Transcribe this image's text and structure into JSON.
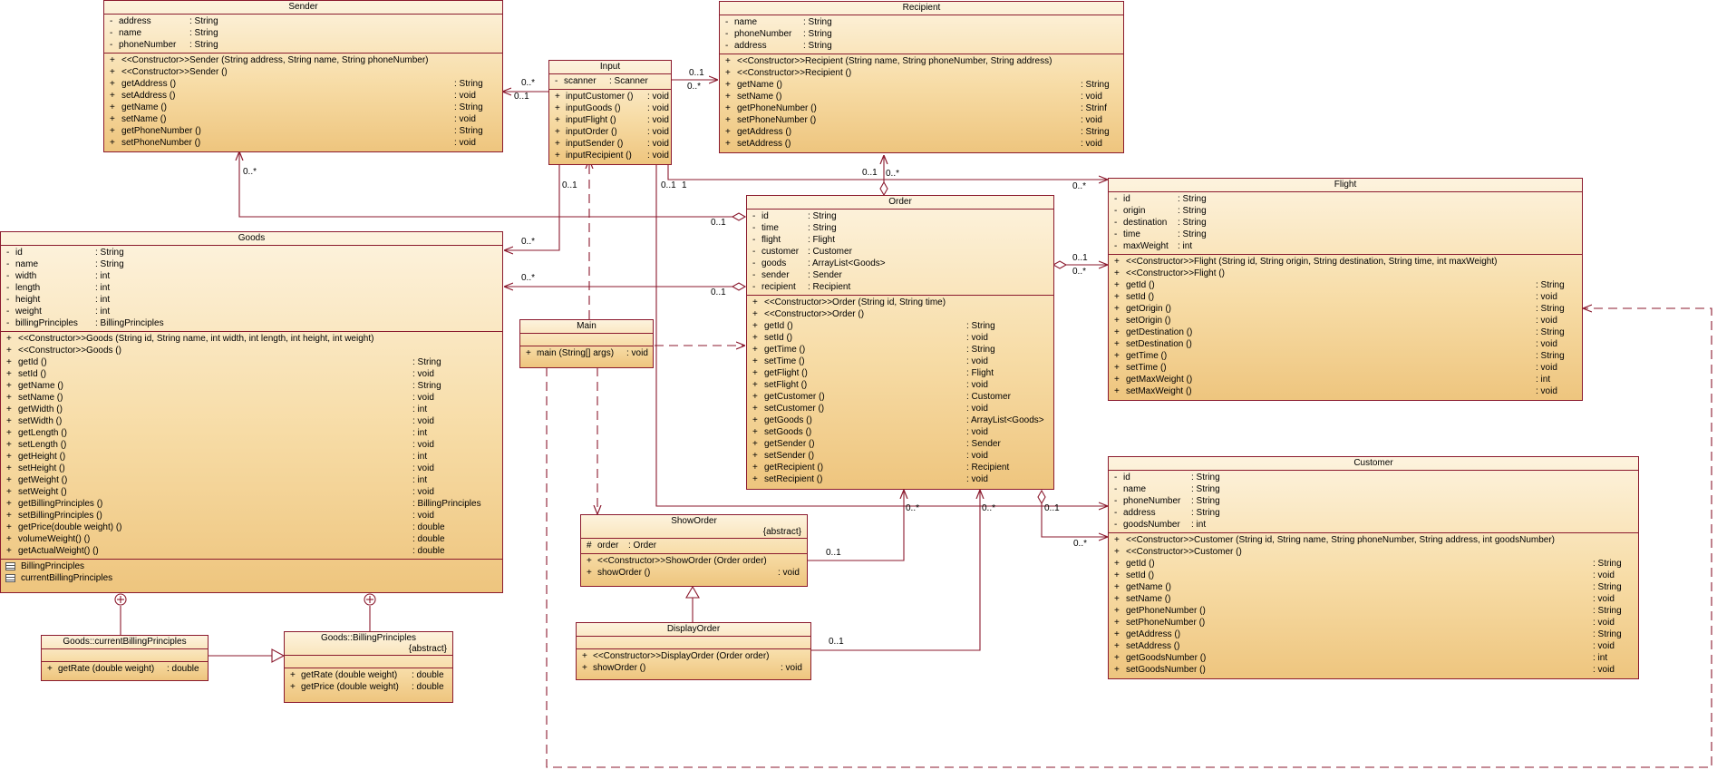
{
  "colors": {
    "border": "#8b1a2e",
    "fill_top": "#fdf3de",
    "fill_bottom": "#eec57e",
    "line": "#8b1a2e"
  },
  "classes": {
    "sender": {
      "name": "Sender",
      "attrs": [
        {
          "v": "-",
          "n": "address",
          "t": ": String"
        },
        {
          "v": "-",
          "n": "name",
          "t": ": String"
        },
        {
          "v": "-",
          "n": "phoneNumber",
          "t": ": String"
        }
      ],
      "ops": [
        {
          "v": "+",
          "n": "<<Constructor>>Sender (String  address, String  name, String  phoneNumber)",
          "t": ""
        },
        {
          "v": "+",
          "n": "<<Constructor>>Sender ()",
          "t": ""
        },
        {
          "v": "+",
          "n": "getAddress ()",
          "t": ": String"
        },
        {
          "v": "+",
          "n": "setAddress ()",
          "t": ": void"
        },
        {
          "v": "+",
          "n": "getName ()",
          "t": ": String"
        },
        {
          "v": "+",
          "n": "setName ()",
          "t": ": void"
        },
        {
          "v": "+",
          "n": "getPhoneNumber ()",
          "t": ": String"
        },
        {
          "v": "+",
          "n": "setPhoneNumber ()",
          "t": ": void"
        }
      ]
    },
    "input": {
      "name": "Input",
      "attrs": [
        {
          "v": "-",
          "n": "scanner",
          "t": ": Scanner"
        }
      ],
      "ops": [
        {
          "v": "+",
          "n": "inputCustomer ()",
          "t": ": void"
        },
        {
          "v": "+",
          "n": "inputGoods ()",
          "t": ": void"
        },
        {
          "v": "+",
          "n": "inputFlight ()",
          "t": ": void"
        },
        {
          "v": "+",
          "n": "inputOrder ()",
          "t": ": void"
        },
        {
          "v": "+",
          "n": "inputSender ()",
          "t": ": void"
        },
        {
          "v": "+",
          "n": "inputRecipient ()",
          "t": ": void"
        }
      ]
    },
    "recipient": {
      "name": "Recipient",
      "attrs": [
        {
          "v": "-",
          "n": "name",
          "t": ": String"
        },
        {
          "v": "-",
          "n": "phoneNumber",
          "t": ": String"
        },
        {
          "v": "-",
          "n": "address",
          "t": ": String"
        }
      ],
      "ops": [
        {
          "v": "+",
          "n": "<<Constructor>>Recipient (String  name, String  phoneNumber, String  address)",
          "t": ""
        },
        {
          "v": "+",
          "n": "<<Constructor>>Recipient ()",
          "t": ""
        },
        {
          "v": "+",
          "n": "getName ()",
          "t": ": String"
        },
        {
          "v": "+",
          "n": "setName ()",
          "t": ": void"
        },
        {
          "v": "+",
          "n": "getPhoneNumber ()",
          "t": ": Strinf"
        },
        {
          "v": "+",
          "n": "setPhoneNumber ()",
          "t": ": void"
        },
        {
          "v": "+",
          "n": "getAddress ()",
          "t": ": String"
        },
        {
          "v": "+",
          "n": "setAddress ()",
          "t": ": void"
        }
      ]
    },
    "flight": {
      "name": "Flight",
      "attrs": [
        {
          "v": "-",
          "n": "id",
          "t": ": String"
        },
        {
          "v": "-",
          "n": "origin",
          "t": ": String"
        },
        {
          "v": "-",
          "n": "destination",
          "t": ": String"
        },
        {
          "v": "-",
          "n": "time",
          "t": ": String"
        },
        {
          "v": "-",
          "n": "maxWeight",
          "t": ": int"
        }
      ],
      "ops": [
        {
          "v": "+",
          "n": "<<Constructor>>Flight (String  id, String  origin, String  destination, String  time, int maxWeight)",
          "t": ""
        },
        {
          "v": "+",
          "n": "<<Constructor>>Flight ()",
          "t": ""
        },
        {
          "v": "+",
          "n": "getId ()",
          "t": ": String"
        },
        {
          "v": "+",
          "n": "setId ()",
          "t": ": void"
        },
        {
          "v": "+",
          "n": "getOrigin ()",
          "t": ": String"
        },
        {
          "v": "+",
          "n": "setOrigin ()",
          "t": ": void"
        },
        {
          "v": "+",
          "n": "getDestination ()",
          "t": ": String"
        },
        {
          "v": "+",
          "n": "setDestination ()",
          "t": ": void"
        },
        {
          "v": "+",
          "n": "getTime ()",
          "t": ": String"
        },
        {
          "v": "+",
          "n": "setTime ()",
          "t": ": void"
        },
        {
          "v": "+",
          "n": "getMaxWeight ()",
          "t": ": int"
        },
        {
          "v": "+",
          "n": "setMaxWeight ()",
          "t": ": void"
        }
      ]
    },
    "order": {
      "name": "Order",
      "attrs": [
        {
          "v": "-",
          "n": "id",
          "t": ": String"
        },
        {
          "v": "-",
          "n": "time",
          "t": ": String"
        },
        {
          "v": "-",
          "n": "flight",
          "t": ": Flight"
        },
        {
          "v": "-",
          "n": "customer",
          "t": ": Customer"
        },
        {
          "v": "-",
          "n": "goods",
          "t": ": ArrayList<Goods>"
        },
        {
          "v": "-",
          "n": "sender",
          "t": ": Sender"
        },
        {
          "v": "-",
          "n": "recipient",
          "t": ": Recipient"
        }
      ],
      "ops": [
        {
          "v": "+",
          "n": "<<Constructor>>Order (String  id, String  time)",
          "t": ""
        },
        {
          "v": "+",
          "n": "<<Constructor>>Order ()",
          "t": ""
        },
        {
          "v": "+",
          "n": "getId ()",
          "t": ": String"
        },
        {
          "v": "+",
          "n": "setId ()",
          "t": ": void"
        },
        {
          "v": "+",
          "n": "getTime ()",
          "t": ": String"
        },
        {
          "v": "+",
          "n": "setTime ()",
          "t": ": void"
        },
        {
          "v": "+",
          "n": "getFlight ()",
          "t": ": Flight"
        },
        {
          "v": "+",
          "n": "setFlight ()",
          "t": ": void"
        },
        {
          "v": "+",
          "n": "getCustomer ()",
          "t": ": Customer"
        },
        {
          "v": "+",
          "n": "setCustomer ()",
          "t": ": void"
        },
        {
          "v": "+",
          "n": "getGoods ()",
          "t": ": ArrayList<Goods>"
        },
        {
          "v": "+",
          "n": "setGoods ()",
          "t": ": void"
        },
        {
          "v": "+",
          "n": "getSender ()",
          "t": ": Sender"
        },
        {
          "v": "+",
          "n": "setSender ()",
          "t": ": void"
        },
        {
          "v": "+",
          "n": "getRecipient ()",
          "t": ": Recipient"
        },
        {
          "v": "+",
          "n": "setRecipient ()",
          "t": ": void"
        }
      ]
    },
    "goods": {
      "name": "Goods",
      "attrs": [
        {
          "v": "-",
          "n": "id",
          "t": ": String"
        },
        {
          "v": "-",
          "n": "name",
          "t": ": String"
        },
        {
          "v": "-",
          "n": "width",
          "t": ": int"
        },
        {
          "v": "-",
          "n": "length",
          "t": ": int"
        },
        {
          "v": "-",
          "n": "height",
          "t": ": int"
        },
        {
          "v": "-",
          "n": "weight",
          "t": ": int"
        },
        {
          "v": "-",
          "n": "billingPrinciples",
          "t": ": BillingPrinciples"
        }
      ],
      "ops": [
        {
          "v": "+",
          "n": "<<Constructor>>Goods (String  id, String  name, int width, int length, int height, int weight)",
          "t": ""
        },
        {
          "v": "+",
          "n": "<<Constructor>>Goods ()",
          "t": ""
        },
        {
          "v": "+",
          "n": "getId ()",
          "t": ": String"
        },
        {
          "v": "+",
          "n": "setId ()",
          "t": ": void"
        },
        {
          "v": "+",
          "n": "getName ()",
          "t": ": String"
        },
        {
          "v": "+",
          "n": "setName ()",
          "t": ": void"
        },
        {
          "v": "+",
          "n": "getWidth ()",
          "t": ": int"
        },
        {
          "v": "+",
          "n": "setWidth ()",
          "t": ": void"
        },
        {
          "v": "+",
          "n": "getLength ()",
          "t": ": int"
        },
        {
          "v": "+",
          "n": "setLength ()",
          "t": ": void"
        },
        {
          "v": "+",
          "n": "getHeight ()",
          "t": ": int"
        },
        {
          "v": "+",
          "n": "setHeight ()",
          "t": ": void"
        },
        {
          "v": "+",
          "n": "getWeight ()",
          "t": ": int"
        },
        {
          "v": "+",
          "n": "setWeight ()",
          "t": ": void"
        },
        {
          "v": "+",
          "n": "getBillingPrinciples ()",
          "t": ": BillingPrinciples"
        },
        {
          "v": "+",
          "n": "setBillingPrinciples ()",
          "t": ": void"
        },
        {
          "v": "+",
          "n": "getPrice(double weight) ()",
          "t": ": double"
        },
        {
          "v": "+",
          "n": "volumeWeight() ()",
          "t": ": double"
        },
        {
          "v": "+",
          "n": "getActualWeight() ()",
          "t": ": double"
        }
      ],
      "inner": [
        "BillingPrinciples",
        "currentBillingPrinciples"
      ]
    },
    "main": {
      "name": "Main",
      "ops": [
        {
          "v": "+",
          "n": "main (String[] args)",
          "t": ": void"
        }
      ]
    },
    "showorder": {
      "name": "ShowOrder",
      "stereo": "{abstract}",
      "attrs": [
        {
          "v": "#",
          "n": "order",
          "t": ": Order"
        }
      ],
      "ops": [
        {
          "v": "+",
          "n": "<<Constructor>>ShowOrder (Order order)",
          "t": ""
        },
        {
          "v": "+",
          "n": "showOrder ()",
          "t": ": void"
        }
      ]
    },
    "displayorder": {
      "name": "DisplayOrder",
      "ops": [
        {
          "v": "+",
          "n": "<<Constructor>>DisplayOrder (Order order)",
          "t": ""
        },
        {
          "v": "+",
          "n": "showOrder ()",
          "t": ": void"
        }
      ]
    },
    "customer": {
      "name": "Customer",
      "attrs": [
        {
          "v": "-",
          "n": "id",
          "t": ": String"
        },
        {
          "v": "-",
          "n": "name",
          "t": ": String"
        },
        {
          "v": "-",
          "n": "phoneNumber",
          "t": ": String"
        },
        {
          "v": "-",
          "n": "address",
          "t": ": String"
        },
        {
          "v": "-",
          "n": "goodsNumber",
          "t": ": int"
        }
      ],
      "ops": [
        {
          "v": "+",
          "n": "<<Constructor>>Customer (String  id, String  name, String  phoneNumber, String  address, int goodsNumber)",
          "t": ""
        },
        {
          "v": "+",
          "n": "<<Constructor>>Customer ()",
          "t": ""
        },
        {
          "v": "+",
          "n": "getId ()",
          "t": ": String"
        },
        {
          "v": "+",
          "n": "setId ()",
          "t": ": void"
        },
        {
          "v": "+",
          "n": "getName ()",
          "t": ": String"
        },
        {
          "v": "+",
          "n": "setName ()",
          "t": ": void"
        },
        {
          "v": "+",
          "n": "getPhoneNumber ()",
          "t": ": String"
        },
        {
          "v": "+",
          "n": "setPhoneNumber ()",
          "t": ": void"
        },
        {
          "v": "+",
          "n": "getAddress ()",
          "t": ": String"
        },
        {
          "v": "+",
          "n": "setAddress ()",
          "t": ": void"
        },
        {
          "v": "+",
          "n": "getGoodsNumber ()",
          "t": ": int"
        },
        {
          "v": "+",
          "n": "setGoodsNumber ()",
          "t": ": void"
        }
      ]
    },
    "currentbilling": {
      "name": "Goods::currentBillingPrinciples",
      "ops": [
        {
          "v": "+",
          "n": "getRate (double weight)",
          "t": ": double"
        }
      ]
    },
    "billing": {
      "name": "Goods::BillingPrinciples",
      "stereo": "{abstract}",
      "ops": [
        {
          "v": "+",
          "n": "getRate (double weight)",
          "t": ": double"
        },
        {
          "v": "+",
          "n": "getPrice (double weight)",
          "t": ": double"
        }
      ]
    }
  },
  "multiplicities": {
    "input_sender_star": "0..*",
    "input_sender_one": "0..1",
    "input_recipient_one": "0..1",
    "input_recipient_star": "0..*",
    "sender_order_star": "0..*",
    "order_sender_one": "0..1",
    "input_goods_one": "0..1",
    "input_goods_star": "0..*",
    "order_goods_star": "0..*",
    "order_goods_one": "0..1",
    "input_order_one": "0..1",
    "input_order_one_b": "1",
    "recipient_order_one": "0..1",
    "recipient_order_star": "0..*",
    "input_flight_star": "0..*",
    "order_flight_one": "0..1",
    "order_flight_star": "0..*",
    "showorder_order_one": "0..1",
    "showorder_order_star": "0..*",
    "input_customer_star": "0..*",
    "order_customer_one": "0..1",
    "order_customer_star": "0..*",
    "displayorder_order_one": "0..1"
  }
}
